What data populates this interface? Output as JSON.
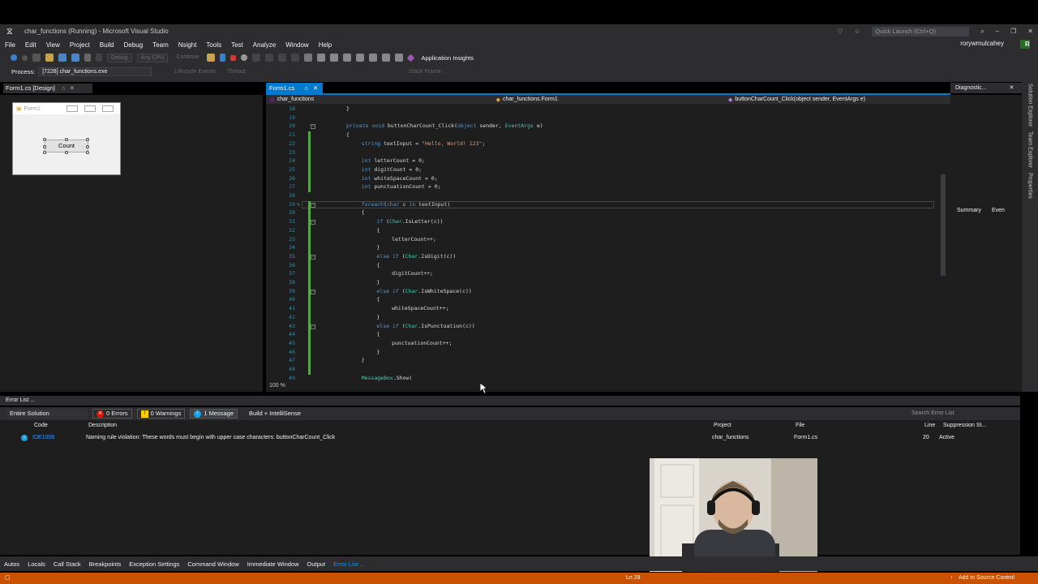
{
  "window": {
    "title": "char_functions (Running) - Microsoft Visual Studio",
    "quick_launch_placeholder": "Quick Launch (Ctrl+Q)",
    "user": "rorywmulcahey",
    "user_initial": "R"
  },
  "menu": [
    "File",
    "Edit",
    "View",
    "Project",
    "Build",
    "Debug",
    "Team",
    "Nsight",
    "Tools",
    "Test",
    "Analyze",
    "Window",
    "Help"
  ],
  "toolbar": {
    "config": "Debug",
    "platform": "Any CPU",
    "continue": "Continue",
    "app_insights": "Application Insights"
  },
  "process_bar": {
    "label": "Process:",
    "process": "[7228] char_functions.exe",
    "lifecycle": "Lifecycle Events",
    "thread": "Thread:",
    "stack_frame": "Stack Frame:"
  },
  "designer": {
    "tab": "Form1.cs [Design]",
    "form_title": "Form1",
    "button": "Count"
  },
  "editor": {
    "tab": "Form1.cs",
    "nav_project": "char_functions",
    "nav_class": "char_functions.Form1",
    "nav_member": "buttonCharCount_Click(object sender, EventArgs e)",
    "zoom": "100 %",
    "lines": [
      {
        "n": "18",
        "indent": 0,
        "text": "}"
      },
      {
        "n": "19",
        "indent": 0,
        "text": ""
      },
      {
        "n": "20",
        "indent": 0,
        "text": "private void buttonCharCount_Click(object sender, EventArgs e)"
      },
      {
        "n": "21",
        "indent": 0,
        "text": "{"
      },
      {
        "n": "22",
        "indent": 1,
        "text": "string textInput = \"Hello, World! 123\";"
      },
      {
        "n": "23",
        "indent": 0,
        "text": ""
      },
      {
        "n": "24",
        "indent": 1,
        "text": "int letterCount = 0;"
      },
      {
        "n": "25",
        "indent": 1,
        "text": "int digitCount = 0;"
      },
      {
        "n": "26",
        "indent": 1,
        "text": "int whiteSpaceCount = 0;"
      },
      {
        "n": "27",
        "indent": 1,
        "text": "int punctuationCount = 0;"
      },
      {
        "n": "28",
        "indent": 0,
        "text": ""
      },
      {
        "n": "29",
        "indent": 1,
        "text": "foreach(char c in textInput)"
      },
      {
        "n": "30",
        "indent": 1,
        "text": "{"
      },
      {
        "n": "31",
        "indent": 2,
        "text": "if (Char.IsLetter(c))"
      },
      {
        "n": "32",
        "indent": 2,
        "text": "{"
      },
      {
        "n": "33",
        "indent": 3,
        "text": "letterCount++;"
      },
      {
        "n": "34",
        "indent": 2,
        "text": "}"
      },
      {
        "n": "35",
        "indent": 2,
        "text": "else if (Char.IsDigit(c))"
      },
      {
        "n": "36",
        "indent": 2,
        "text": "{"
      },
      {
        "n": "37",
        "indent": 3,
        "text": "digitCount++;"
      },
      {
        "n": "38",
        "indent": 2,
        "text": "}"
      },
      {
        "n": "39",
        "indent": 2,
        "text": "else if (Char.IsWhiteSpace(c))"
      },
      {
        "n": "40",
        "indent": 2,
        "text": "{"
      },
      {
        "n": "41",
        "indent": 3,
        "text": "whiteSpaceCount++;"
      },
      {
        "n": "42",
        "indent": 2,
        "text": "}"
      },
      {
        "n": "43",
        "indent": 2,
        "text": "else if (Char.IsPunctuation(c))"
      },
      {
        "n": "44",
        "indent": 2,
        "text": "{"
      },
      {
        "n": "45",
        "indent": 3,
        "text": "punctuationCount++;"
      },
      {
        "n": "46",
        "indent": 2,
        "text": "}"
      },
      {
        "n": "47",
        "indent": 1,
        "text": "}"
      },
      {
        "n": "48",
        "indent": 0,
        "text": ""
      },
      {
        "n": "49",
        "indent": 1,
        "text": "MessageBox.Show("
      }
    ]
  },
  "diagnostics": {
    "tab": "Diagnostic...",
    "summary": "Summary",
    "events": "Even"
  },
  "side_tabs": [
    "Solution Explorer",
    "Team Explorer",
    "Properties"
  ],
  "error_list": {
    "title": "Error List ...",
    "scope": "Entire Solution",
    "errors": "0 Errors",
    "warnings": "0 Warnings",
    "messages": "1 Message",
    "build": "Build + IntelliSense",
    "search_placeholder": "Search Error List",
    "columns": {
      "code": "Code",
      "description": "Description",
      "project": "Project",
      "file": "File",
      "line": "Line",
      "suppression": "Suppression St..."
    },
    "rows": [
      {
        "code": "IDE1006",
        "description": "Naming rule violation: These words must begin with upper case characters: buttonCharCount_Click",
        "project": "char_functions",
        "file": "Form1.cs",
        "line": "20",
        "suppression": "Active"
      }
    ]
  },
  "bottom_tabs": [
    "Autos",
    "Locals",
    "Call Stack",
    "Breakpoints",
    "Exception Settings",
    "Command Window",
    "Immediate Window",
    "Output",
    "Error List ..."
  ],
  "status": {
    "ln": "Ln 29",
    "source_control": "Add to Source Control"
  },
  "colors": {
    "accent": "#007acc",
    "status_bar": "#ca5100",
    "error_badge": "#e51400",
    "warning_badge": "#ffcc00",
    "info_badge": "#1ba1e2"
  }
}
